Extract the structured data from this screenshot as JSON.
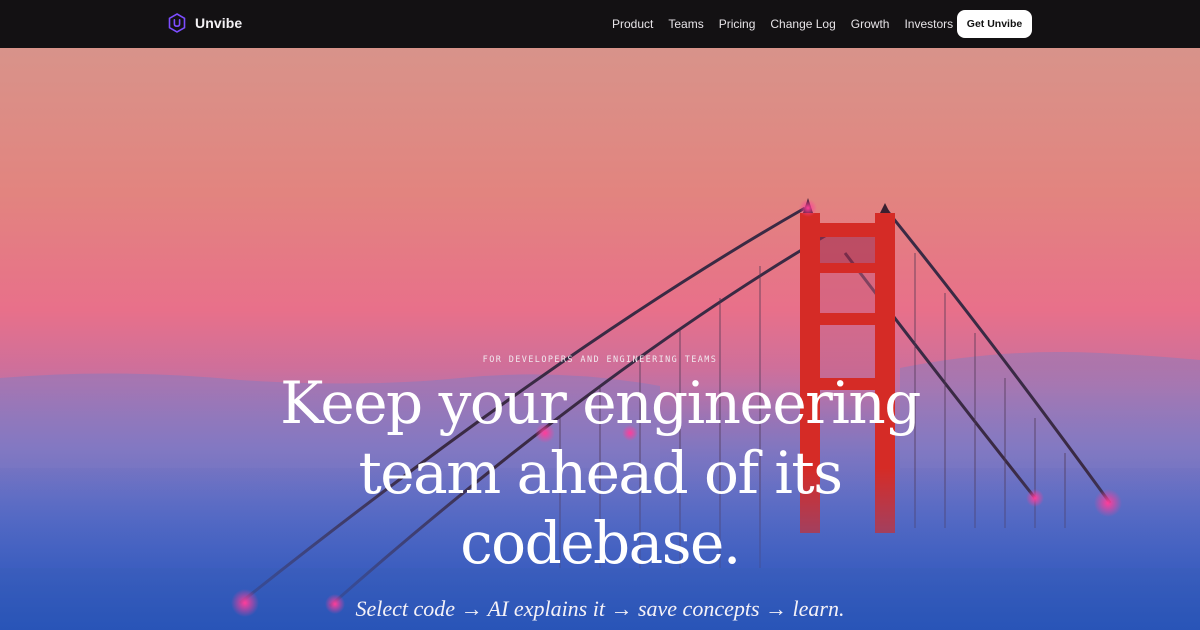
{
  "brand": {
    "name": "Unvibe",
    "logo_icon": "hexagon-u-logo-icon",
    "logo_color": "#7c4dff"
  },
  "nav": {
    "links": [
      "Product",
      "Teams",
      "Pricing",
      "Change Log",
      "Growth",
      "Investors"
    ],
    "cta_label": "Get Unvibe"
  },
  "hero": {
    "eyebrow": "FOR DEVELOPERS AND ENGINEERING TEAMS",
    "headline_lines": [
      "Keep your engineering",
      "team ahead of its",
      "codebase."
    ],
    "tagline": "Select code → AI explains it → save concepts → learn.",
    "background_image": "golden-gate-bridge-in-fog-at-sunset",
    "colors": {
      "sky_top": "#dc8d88",
      "sky_mid": "#e86b85",
      "fog": "#5e68c0",
      "water": "#1e4fa8",
      "bridge": "#d02a2a"
    }
  }
}
